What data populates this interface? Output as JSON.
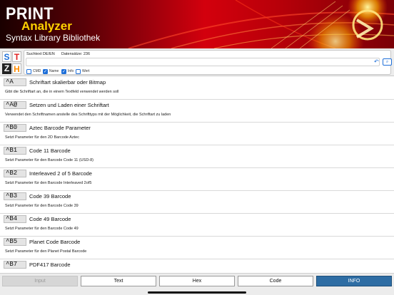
{
  "app": {
    "title_line1": "PRINT",
    "title_line2": "Analyzer",
    "subtitle": "Syntax Library Bibliothek"
  },
  "sidebar_tiles": [
    "S",
    "T",
    "Z",
    "H"
  ],
  "search": {
    "language_label": "Suchtext DE/EN",
    "count_label": "Datensätze: 236",
    "value": "",
    "undo_icon": "undo-icon",
    "search_icon": "search-icon",
    "options": [
      {
        "label": "CMD",
        "checked": false
      },
      {
        "label": "Name",
        "checked": true
      },
      {
        "label": "Info",
        "checked": true
      },
      {
        "label": "Wert",
        "checked": false
      }
    ]
  },
  "commands": [
    {
      "code": "^A",
      "title": "Schriftart skalierbar oder Bitmap",
      "desc": "Gibt die Schriftart an, die in einem Textfeld verwendet werden soll"
    },
    {
      "code": "^A@",
      "title": "Setzen und Laden einer Schriftart",
      "desc": "Verwendet den Schriftnamen anstelle des Schrifttyps mit der Möglichkeit, die Schriftart zu laden"
    },
    {
      "code": "^B0",
      "title": "Aztec Barcode Parameter",
      "desc": "Setzt Parameter für den 2D Barcode Aztec"
    },
    {
      "code": "^B1",
      "title": "Code 11 Barcode",
      "desc": "Setzt Parameter für den Barcode Code 11 (USD-8)"
    },
    {
      "code": "^B2",
      "title": "Interleaved 2 of 5 Barcode",
      "desc": "Setzt Parameter für den Barcode Interleaved 2of5"
    },
    {
      "code": "^B3",
      "title": "Code 39 Barcode",
      "desc": "Setzt Parameter für den Barcode Code 39"
    },
    {
      "code": "^B4",
      "title": "Code 49 Barcode",
      "desc": "Setzt Parameter für den Barcode Code 49"
    },
    {
      "code": "^B5",
      "title": "Planet Code Barcode",
      "desc": "Setzt Parameter für den Planet Postal Barcode"
    },
    {
      "code": "^B7",
      "title": "PDF417 Barcode",
      "desc": ""
    }
  ],
  "tabs": [
    {
      "label": "Input",
      "state": "disabled"
    },
    {
      "label": "Text",
      "state": "normal"
    },
    {
      "label": "Hex",
      "state": "normal"
    },
    {
      "label": "Code",
      "state": "normal"
    },
    {
      "label": "INFO",
      "state": "active"
    }
  ],
  "colors": {
    "accent": "#1e6fd9",
    "active_tab": "#2e6da4",
    "brand_yellow": "#ffd200",
    "banner_red": "#d3000d"
  }
}
